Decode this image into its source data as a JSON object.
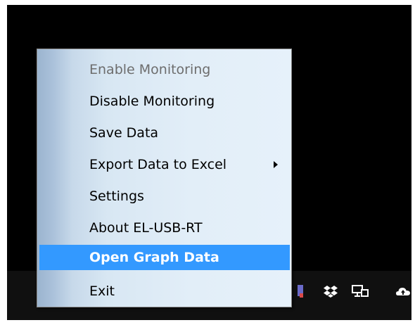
{
  "context_menu": {
    "items": [
      {
        "label": "Enable Monitoring",
        "enabled": false
      },
      {
        "label": "Disable Monitoring",
        "enabled": true
      },
      {
        "label": "Save Data",
        "enabled": true
      },
      {
        "label": "Export Data to Excel",
        "enabled": true,
        "has_submenu": true
      },
      {
        "label": "Settings",
        "enabled": true
      },
      {
        "label": "About EL-USB-RT",
        "enabled": true
      },
      {
        "label": "Open Graph Data",
        "enabled": true,
        "highlighted": true
      },
      {
        "label": "Exit",
        "enabled": true
      }
    ],
    "highlight_color": "#3399ff"
  },
  "tray": {
    "icons": [
      "el-usb-app-icon",
      "dropbox-icon",
      "network-icon",
      "onedrive-cloud-icon"
    ]
  }
}
